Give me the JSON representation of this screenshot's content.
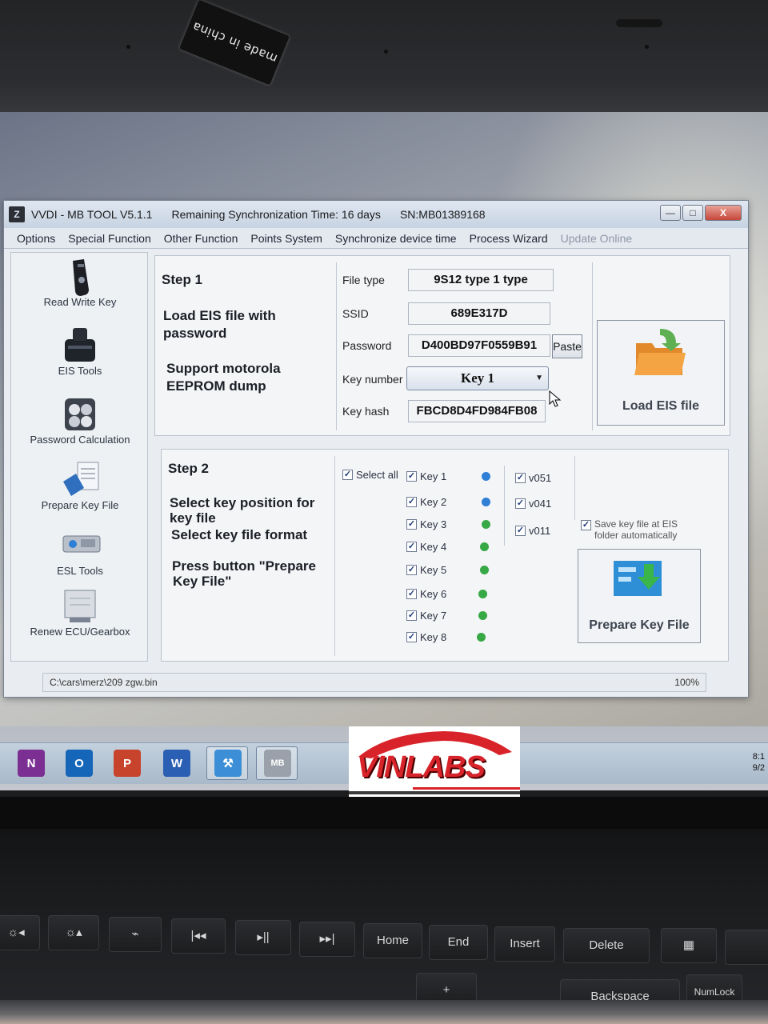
{
  "sticker": {
    "text": "made in china"
  },
  "window": {
    "title": "VVDI - MB TOOL V5.1.1",
    "sync_time": "Remaining Synchronization Time: 16 days",
    "serial": "SN:MB01389168",
    "icon_glyph": "Z",
    "controls": {
      "minimize": "—",
      "maximize": "□",
      "close": "X"
    }
  },
  "menu": [
    {
      "label": "Options"
    },
    {
      "label": "Special Function"
    },
    {
      "label": "Other Function"
    },
    {
      "label": "Points System"
    },
    {
      "label": "Synchronize device time"
    },
    {
      "label": "Process Wizard"
    },
    {
      "label": "Update Online"
    }
  ],
  "sidebar": {
    "items": [
      {
        "label": "Read Write Key",
        "icon": "car-key-icon"
      },
      {
        "label": "EIS Tools",
        "icon": "eis-module-icon"
      },
      {
        "label": "Password Calculation",
        "icon": "password-lock-icon"
      },
      {
        "label": "Prepare Key File",
        "icon": "key-file-icon"
      },
      {
        "label": "ESL Tools",
        "icon": "esl-module-icon"
      },
      {
        "label": "Renew ECU/Gearbox",
        "icon": "ecu-module-icon"
      }
    ]
  },
  "step1": {
    "title": "Step 1",
    "line1": "Load EIS file with",
    "line2": "password",
    "line3": "Support motorola",
    "line4": "EEPROM dump",
    "fields": {
      "file_type_label": "File type",
      "file_type_value": "9S12 type 1 type",
      "ssid_label": "SSID",
      "ssid_value": "689E317D",
      "password_label": "Password",
      "password_value": "D400BD97F0559B91",
      "paste_label": "Paste",
      "key_number_label": "Key number",
      "key_number_value": "Key 1",
      "key_hash_label": "Key hash",
      "key_hash_value": "FBCD8D4FD984FB08"
    },
    "load_button": "Load EIS file"
  },
  "step2": {
    "title": "Step 2",
    "line1": "Select key position for",
    "line2": "key file",
    "line3": "Select key file format",
    "line4": "Press button \"Prepare",
    "line5": "Key File\"",
    "select_all": "Select all",
    "check_mark": "✓",
    "keys": [
      {
        "label": "Key 1",
        "status_color": "#2f7fd6"
      },
      {
        "label": "Key 2",
        "status_color": "#2f7fd6"
      },
      {
        "label": "Key 3",
        "status_color": "#36a844"
      },
      {
        "label": "Key 4",
        "status_color": "#36a844"
      },
      {
        "label": "Key 5",
        "status_color": "#36a844"
      },
      {
        "label": "Key 6",
        "status_color": "#36a844"
      },
      {
        "label": "Key 7",
        "status_color": "#36a844"
      },
      {
        "label": "Key 8",
        "status_color": "#36a844"
      }
    ],
    "formats": [
      {
        "label": "v051"
      },
      {
        "label": "v041"
      },
      {
        "label": "v011"
      }
    ],
    "save_option_line1": "Save key file at EIS",
    "save_option_line2": "folder automatically",
    "prepare_button": "Prepare Key File"
  },
  "status": {
    "path": "C:\\cars\\merz\\209 zgw.bin",
    "progress_text": "100%"
  },
  "taskbar": {
    "apps": [
      {
        "glyph": "N",
        "icon": "onenote-icon",
        "color": "#7b2f93"
      },
      {
        "glyph": "O",
        "icon": "outlook-icon",
        "color": "#1565b8"
      },
      {
        "glyph": "P",
        "icon": "powerpoint-icon",
        "color": "#c8432c"
      },
      {
        "glyph": "W",
        "icon": "word-icon",
        "color": "#2b5fb3"
      },
      {
        "glyph": "⚒",
        "icon": "vvdi-tool-icon",
        "color": "#3c8fd6"
      },
      {
        "glyph": "MB",
        "icon": "vvdi-mb-icon",
        "color": "#9aa1aa"
      }
    ],
    "tray_time": "8:1",
    "tray_date": "9/2"
  },
  "watermark": {
    "text": "VINLABS"
  },
  "keyboard": {
    "keys": [
      "☼◂",
      "☼▴",
      "⌁",
      "|◂◂",
      "▸||",
      "▸▸|",
      "Home",
      "End",
      "Insert",
      "Delete",
      "▦"
    ],
    "lower_keys": [
      "+",
      "Backspace",
      "NumLock"
    ]
  },
  "colors": {
    "window_bg": "#e9ecf0",
    "titlebar": "#c7d3e2",
    "accent_blue": "#2f7fd6",
    "accent_green": "#36a844",
    "logo_red": "#d8232a"
  }
}
